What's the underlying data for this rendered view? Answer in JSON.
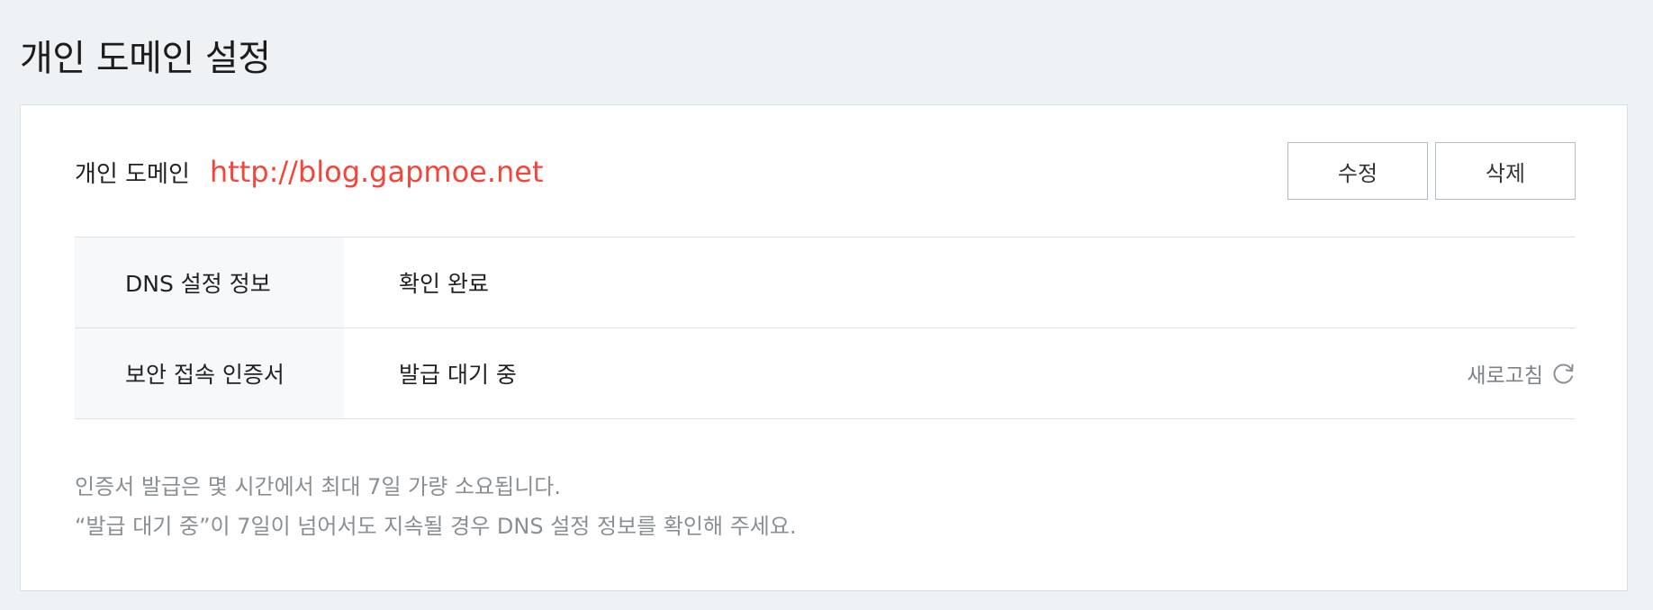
{
  "page": {
    "title": "개인 도메인 설정"
  },
  "domain": {
    "label": "개인 도메인",
    "url": "http://blog.gapmoe.net",
    "url_color": "#f2463a"
  },
  "actions": {
    "edit_label": "수정",
    "delete_label": "삭제"
  },
  "info_rows": [
    {
      "key": "DNS 설정 정보",
      "value": "확인 완료"
    },
    {
      "key": "보안 접속 인증서",
      "value": "발급 대기 중"
    }
  ],
  "refresh": {
    "label": "새로고침",
    "icon": "refresh-icon"
  },
  "notes": [
    "인증서 발급은 몇 시간에서 최대 7일 가량 소요됩니다.",
    "“발급 대기 중”이 7일이 넘어서도 지속될 경우 DNS 설정 정보를 확인해 주세요."
  ]
}
